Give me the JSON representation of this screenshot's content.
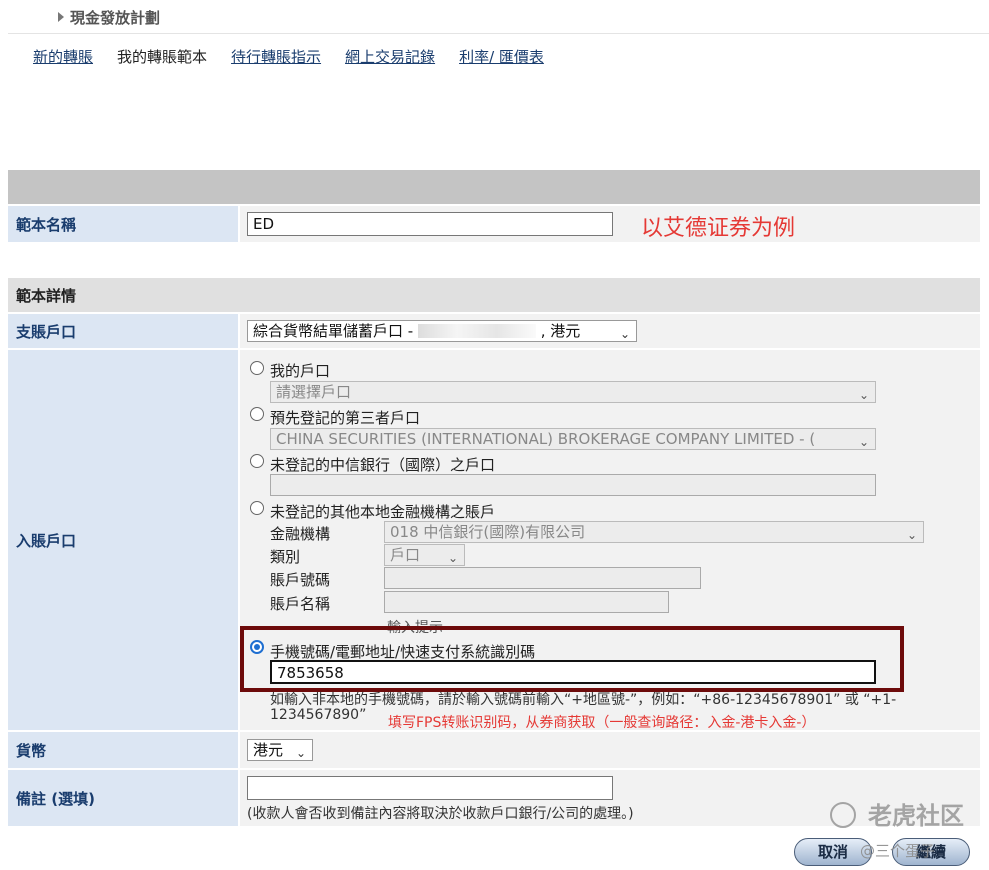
{
  "header": {
    "section_title": "現金發放計劃"
  },
  "nav": {
    "items": [
      {
        "label": "新的轉賬"
      },
      {
        "label": "我的轉賬範本"
      },
      {
        "label": "待行轉賬指示"
      },
      {
        "label": "網上交易記錄"
      },
      {
        "label": "利率/ 匯價表"
      }
    ]
  },
  "template_name": {
    "label": "範本名稱",
    "value": "ED",
    "annotation": "以艾德证券为例"
  },
  "details": {
    "heading": "範本詳情"
  },
  "debit_account": {
    "label": "支賬戶口",
    "value_prefix": "綜合貨幣結單儲蓄戶口 -",
    "value_suffix": ", 港元"
  },
  "credit_account": {
    "label": "入賬戶口",
    "my_account": {
      "label": "我的戶口",
      "placeholder": "請選擇戶口"
    },
    "registered_third_party": {
      "label": "預先登記的第三者戶口",
      "value": "CHINA SECURITIES (INTERNATIONAL) BROKERAGE COMPANY LIMITED - ("
    },
    "unregistered_citic": {
      "label": "未登記的中信銀行（國際）之戶口",
      "value": ""
    },
    "unregistered_other": {
      "label": "未登記的其他本地金融機構之賬戶",
      "institution_label": "金融機構",
      "institution_value": "018 中信銀行(國際)有限公司",
      "type_label": "類別",
      "type_value": "戶口",
      "account_no_label": "賬戶號碼",
      "account_name_label": "賬戶名稱",
      "input_hint": "輸入提示"
    },
    "fps": {
      "label": "手機號碼/電郵地址/快速支付系統識別碼",
      "value": "7853658",
      "help_line1": "如輸入非本地的手機號碼，請於輸入號碼前輸入“+地區號-”，例如：“+86-12345678901” 或 “+1-",
      "help_line2": "1234567890”",
      "annotation": "填写FPS转账识别码，从券商获取（一般查询路径：入金-港卡入金-）"
    }
  },
  "currency": {
    "label": "貨幣",
    "value": "港元"
  },
  "remarks": {
    "label": "備註 (選填)",
    "value": "",
    "note": "(收款人會否收到備註內容將取決於收款戶口銀行/公司的處理。)"
  },
  "buttons": {
    "cancel": "取消",
    "next": "繼續"
  },
  "watermark": {
    "brand": "老虎社区",
    "user": "@三个蛋子"
  },
  "colors": {
    "label_bg": "#dce6f3",
    "label_text": "#1a3d6e",
    "highlight_border": "#6d0b0b",
    "annotation_red": "#e53935",
    "radio_selected": "#1f6fd1"
  }
}
